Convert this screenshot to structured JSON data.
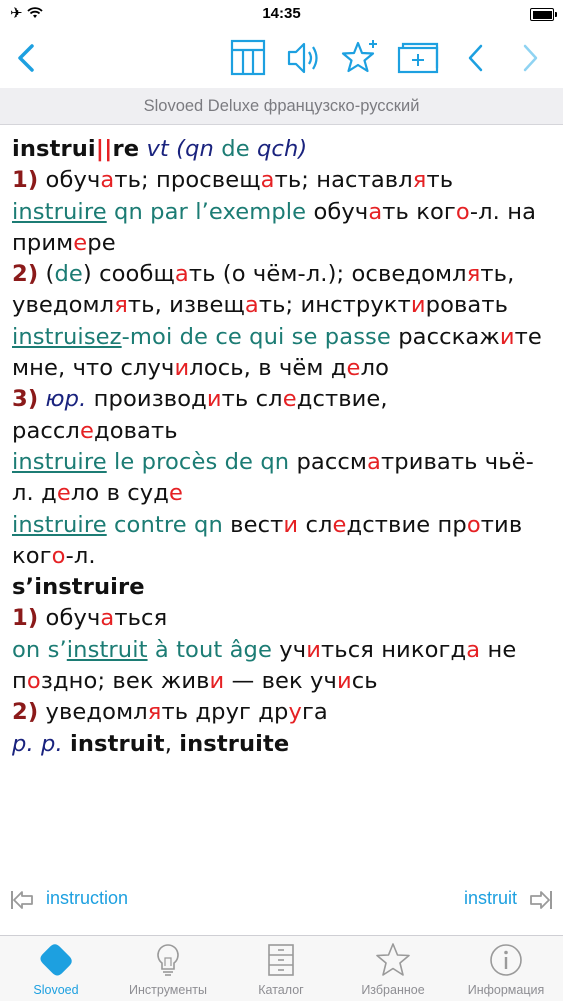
{
  "status_bar": {
    "time": "14:35"
  },
  "subtitle": "Slovoed Deluxe французско-русский",
  "headword": {
    "part1": "instrui",
    "separator": "||",
    "part2": "re",
    "pos": "vt",
    "grammar_open": "(",
    "grammar_qn": "qn",
    "grammar_de": " de ",
    "grammar_qch": "qch",
    "grammar_close": ")"
  },
  "nav": {
    "prev": "instruction",
    "next": "instruit"
  },
  "tabs": [
    {
      "label": "Slovoed"
    },
    {
      "label": "Инструменты"
    },
    {
      "label": "Каталог"
    },
    {
      "label": "Избранное"
    },
    {
      "label": "Информация"
    }
  ],
  "colors": {
    "accent": "#1da0e0",
    "example": "#1c7c74",
    "stress": "#e52124",
    "sense_number": "#8b1a1a",
    "label": "#1a237e"
  }
}
